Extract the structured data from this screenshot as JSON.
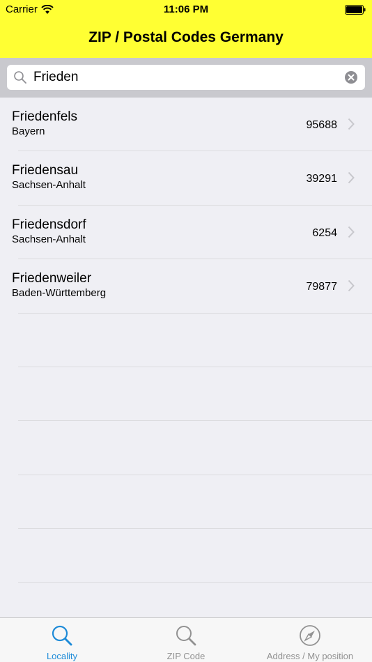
{
  "status_bar": {
    "carrier": "Carrier",
    "time": "11:06 PM"
  },
  "nav": {
    "title": "ZIP / Postal Codes Germany"
  },
  "search": {
    "value": "Frieden",
    "placeholder": ""
  },
  "results": [
    {
      "name": "Friedenfels",
      "state": "Bayern",
      "zip": "95688"
    },
    {
      "name": "Friedensau",
      "state": "Sachsen-Anhalt",
      "zip": "39291"
    },
    {
      "name": "Friedensdorf",
      "state": "Sachsen-Anhalt",
      "zip": "6254"
    },
    {
      "name": "Friedenweiler",
      "state": "Baden-Württemberg",
      "zip": "79877"
    }
  ],
  "tabs": [
    {
      "label": "Locality",
      "icon": "magnifier-icon",
      "active": true
    },
    {
      "label": "ZIP Code",
      "icon": "magnifier-icon",
      "active": false
    },
    {
      "label": "Address / My position",
      "icon": "compass-icon",
      "active": false
    }
  ],
  "colors": {
    "header": "#ffff33",
    "accent": "#1e8bd8",
    "inactive": "#929292"
  }
}
